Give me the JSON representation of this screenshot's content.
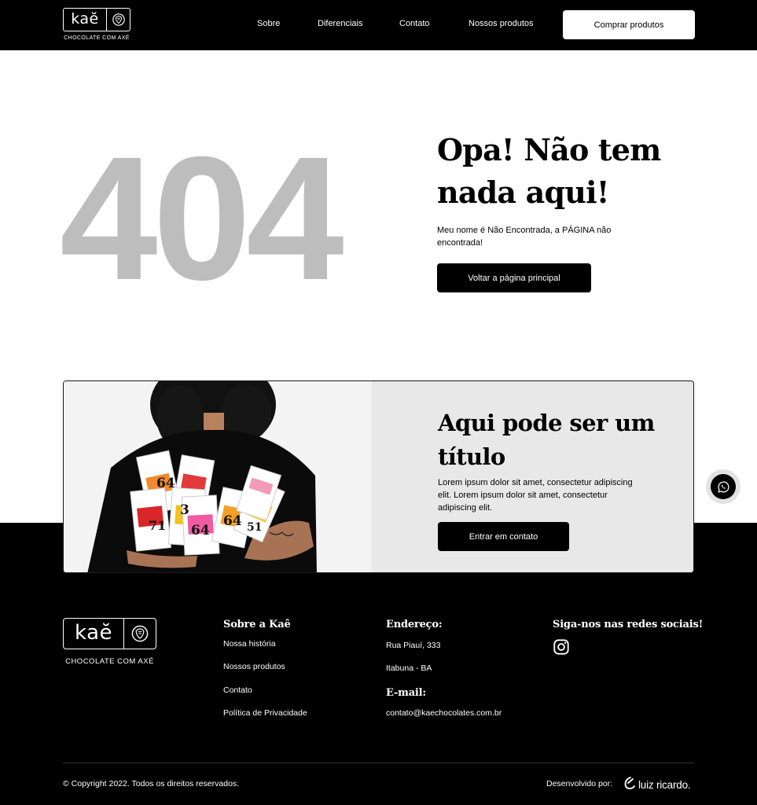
{
  "header": {
    "logo_word": "kaĕ",
    "logo_tagline": "CHOCOLATE COM AXÉ",
    "nav": [
      "Sobre",
      "Diferenciais",
      "Contato",
      "Nossos produtos"
    ],
    "cta": "Comprar produtos"
  },
  "hero": {
    "code": "404",
    "title": "Opa! Não tem nada aqui!",
    "text": "Meu nome é Não Encontrada, a PÁGINA não encontrada!",
    "button": "Voltar a página principal"
  },
  "banner": {
    "title": "Aqui pode ser um título",
    "text": "Lorem ipsum dolor sit amet, consectetur adipiscing elit. Lorem ipsum dolor sit amet, consectetur adipiscing elit.",
    "button": "Entrar em contato",
    "bars": [
      "64",
      "71",
      "3",
      "64",
      "64",
      "51"
    ]
  },
  "footer": {
    "logo_word": "kaĕ",
    "logo_tagline": "CHOCOLATE COM AXÉ",
    "about_title": "Sobre a Kaê",
    "about_links": [
      "Nossa história",
      "Nossos produtos",
      "Contato",
      "Política de Privacidade"
    ],
    "address_title": "Endereço:",
    "address_lines": [
      "Rua Piauí, 333",
      "Itabuna - BA"
    ],
    "email_title": "E-mail:",
    "email": "contato@kaechocolates.com.br",
    "social_title": "Siga-nos nas redes sociais!",
    "copyright": "© Copyright 2022. Todos os direitos reservados.",
    "developed_by": "Desenvolvido por:",
    "developer": "luiz ricardo."
  },
  "colors": {
    "header_bg": "#000000",
    "code_gray": "#bdbdbd",
    "banner_bg": "#e8e8e8",
    "button_bg": "#000000"
  },
  "icons": [
    "cacao-icon",
    "whatsapp-icon",
    "instagram-icon",
    "developer-logo-icon"
  ]
}
